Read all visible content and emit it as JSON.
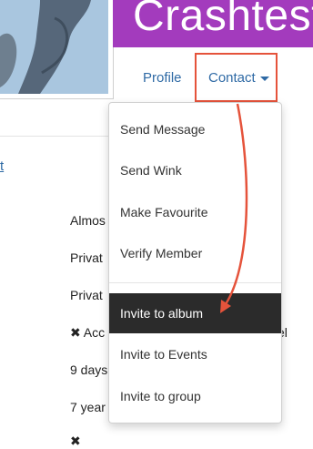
{
  "profile": {
    "banner_title": "Crashteste",
    "avatar_alt": "member photo"
  },
  "nav": {
    "profile_label": "Profile",
    "contact_label": "Contact"
  },
  "left_link": "t",
  "background_rows": [
    "Almos",
    "Privat",
    "Privat",
    "Acc",
    "9 days",
    "7 year",
    ""
  ],
  "background_fragment": "el",
  "contact_menu": {
    "items": [
      "Send Message",
      "Send Wink",
      "Make Favourite",
      "Verify Member",
      "Invite to album",
      "Invite to Events",
      "Invite to group"
    ],
    "highlighted_item": "Invite to album"
  },
  "colors": {
    "banner": "#a33bbd",
    "link": "#2f6aa5",
    "highlight_box": "#e5533b",
    "annotation_arrow": "#e5533b",
    "active_item_bg": "#2b2b2b"
  }
}
